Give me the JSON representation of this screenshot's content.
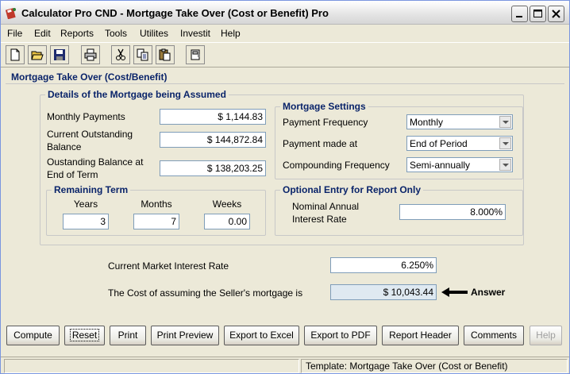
{
  "window": {
    "title": "Calculator Pro CND - Mortgage Take Over (Cost or Benefit) Pro"
  },
  "menu": [
    "File",
    "Edit",
    "Reports",
    "Tools",
    "Utilites",
    "Investit",
    "Help"
  ],
  "toolbar_icons": [
    "new-icon",
    "open-icon",
    "save-icon",
    "print-icon",
    "cut-icon",
    "copy-icon",
    "paste-icon",
    "calculator-icon"
  ],
  "panel": {
    "title": "Mortgage Take Over (Cost/Benefit)",
    "details": {
      "title": "Details of the Mortgage being Assumed",
      "monthly_payments_label": "Monthly Payments",
      "monthly_payments_value": "$ 1,144.83",
      "current_balance_label_1": "Current Outstanding",
      "current_balance_label_2": "Balance",
      "current_balance_value": "$ 144,872.84",
      "end_balance_label_1": "Oustanding Balance at",
      "end_balance_label_2": "End of Term",
      "end_balance_value": "$ 138,203.25"
    },
    "remaining_term": {
      "title": "Remaining Term",
      "years_label": "Years",
      "months_label": "Months",
      "weeks_label": "Weeks",
      "years_value": "3",
      "months_value": "7",
      "weeks_value": "0.00"
    },
    "settings": {
      "title": "Mortgage Settings",
      "payment_frequency_label": "Payment Frequency",
      "payment_frequency_value": "Monthly",
      "payment_made_label": "Payment made at",
      "payment_made_value": "End of Period",
      "compounding_label": "Compounding Frequency",
      "compounding_value": "Semi-annually"
    },
    "optional": {
      "title": "Optional Entry for Report Only",
      "rate_label_1": "Nominal Annual",
      "rate_label_2": "Interest Rate",
      "rate_value": "8.000%"
    },
    "market_rate_label": "Current Market Interest Rate",
    "market_rate_value": "6.250%",
    "cost_label": "The Cost of assuming the Seller's mortgage is",
    "cost_value": "$ 10,043.44",
    "answer_label": "Answer"
  },
  "buttons": {
    "compute": "Compute",
    "reset": "Reset",
    "print": "Print",
    "print_preview": "Print Preview",
    "export_excel": "Export to Excel",
    "export_pdf": "Export to PDF",
    "report_header": "Report Header",
    "comments": "Comments",
    "help": "Help"
  },
  "status": {
    "template": "Template: Mortgage Take Over (Cost or Benefit)"
  }
}
